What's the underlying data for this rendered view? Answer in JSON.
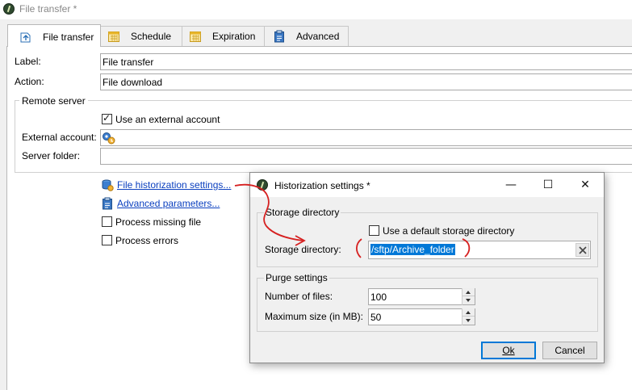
{
  "window": {
    "title": "File transfer *"
  },
  "tabs": [
    {
      "label": "File transfer",
      "icon": "file-transfer-icon",
      "active": true
    },
    {
      "label": "Schedule",
      "icon": "calendar-icon"
    },
    {
      "label": "Expiration",
      "icon": "calendar-icon"
    },
    {
      "label": "Advanced",
      "icon": "clipboard-icon"
    }
  ],
  "form": {
    "label_caption": "Label:",
    "label_value": "File transfer",
    "action_caption": "Action:",
    "action_value": "File download"
  },
  "remote_server": {
    "title": "Remote server",
    "use_external_account": {
      "label": "Use an external account",
      "checked": true
    },
    "external_account_caption": "External account:",
    "external_account_value": "",
    "server_folder_caption": "Server folder:",
    "server_folder_value": ""
  },
  "links": {
    "historization": "File historization settings...",
    "advanced_params": "Advanced parameters..."
  },
  "options": {
    "process_missing": {
      "label": "Process missing file",
      "checked": false
    },
    "process_errors": {
      "label": "Process errors",
      "checked": false
    }
  },
  "dialog": {
    "title": "Historization settings *",
    "controls": {
      "minimize": "—",
      "maximize": "☐",
      "close": "✕"
    },
    "storage_group": {
      "title": "Storage directory",
      "use_default": {
        "label": "Use a default storage directory",
        "checked": false
      },
      "directory_caption": "Storage directory:",
      "directory_value": "/sftp/Archive_folder"
    },
    "purge_group": {
      "title": "Purge settings",
      "number_caption": "Number of files:",
      "number_value": "100",
      "maxsize_caption": "Maximum size (in MB):",
      "maxsize_value": "50"
    },
    "ok_label": "Ok",
    "cancel_label": "Cancel"
  },
  "colors": {
    "link": "#0a3fbf",
    "selection": "#0078d7",
    "annotation": "#d62020",
    "default_button_border": "#0078d7"
  }
}
